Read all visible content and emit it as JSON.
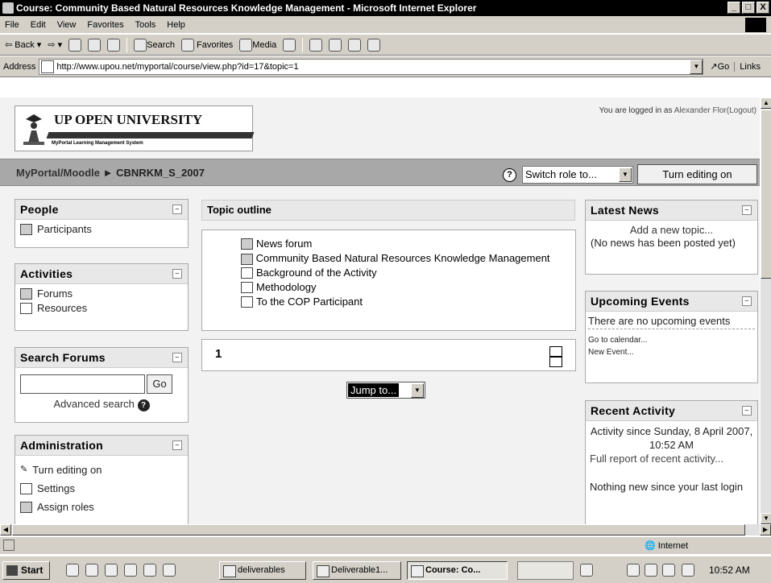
{
  "window": {
    "title": "Course: Community Based Natural Resources Knowledge Management - Microsoft Internet Explorer",
    "buttons": [
      "_",
      "□",
      "X"
    ]
  },
  "menubar": [
    "File",
    "Edit",
    "View",
    "Favorites",
    "Tools",
    "Help"
  ],
  "toolbar": {
    "back": "Back",
    "search": "Search",
    "favorites": "Favorites",
    "media": "Media"
  },
  "addressbar": {
    "label": "Address",
    "url": "http://www.upou.net/myportal/course/view.php?id=17&topic=1",
    "go": "Go",
    "links": "Links"
  },
  "site": {
    "logo_title": "UP OPEN UNIVERSITY",
    "logo_subtitle": "MyPortal Learning Management System",
    "login_prefix": "You are logged in as",
    "login_user": "Alexander Flor",
    "logout": "(Logout)"
  },
  "navbar": {
    "home": "MyPortal/Moodle",
    "separator": "►",
    "course": "CBNRKM_S_2007",
    "help": "?",
    "switch_role": "Switch role to...",
    "turn_editing_button": "Turn editing on"
  },
  "blocks_left": {
    "people": {
      "title": "People",
      "items": [
        "Participants"
      ]
    },
    "activities": {
      "title": "Activities",
      "items": [
        "Forums",
        "Resources"
      ]
    },
    "search": {
      "title": "Search Forums",
      "go": "Go",
      "advanced": "Advanced search"
    },
    "admin": {
      "title": "Administration",
      "items": [
        "Turn editing on",
        "Settings",
        "Assign roles"
      ]
    }
  },
  "main": {
    "topic_outline": "Topic outline",
    "items": [
      "News forum",
      "Community Based Natural Resources Knowledge Management",
      "Background of the Activity",
      "Methodology",
      "To the COP Participant"
    ],
    "section_number": "1",
    "jump_to": "Jump to..."
  },
  "blocks_right": {
    "news": {
      "title": "Latest News",
      "add": "Add a new topic...",
      "empty": "(No news has been posted yet)"
    },
    "events": {
      "title": "Upcoming Events",
      "none": "There are no upcoming events",
      "calendar": "Go to calendar...",
      "new_event": "New Event..."
    },
    "recent": {
      "title": "Recent Activity",
      "since": "Activity since Sunday, 8 April 2007, 10:52 AM",
      "full": "Full report of recent activity...",
      "nothing": "Nothing new since your last login"
    }
  },
  "statusbar": {
    "zone": "Internet"
  },
  "taskbar": {
    "start": "Start",
    "tasks": [
      "deliverables",
      "Deliverable1...",
      "Course: Co..."
    ],
    "clock": "10:52 AM"
  }
}
